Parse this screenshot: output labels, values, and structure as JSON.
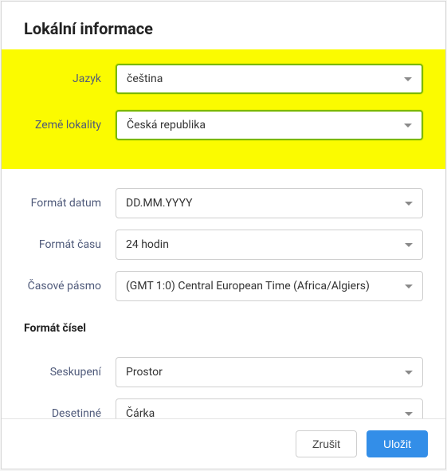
{
  "dialog": {
    "title": "Lokální informace"
  },
  "fields": {
    "language": {
      "label": "Jazyk",
      "value": "čeština"
    },
    "country": {
      "label": "Země lokality",
      "value": "Česká republika"
    },
    "dateFormat": {
      "label": "Formát datum",
      "value": "DD.MM.YYYY"
    },
    "timeFormat": {
      "label": "Formát času",
      "value": "24 hodin"
    },
    "timezone": {
      "label": "Časové pásmo",
      "value": "(GMT 1:0) Central European Time (Africa/Algiers)"
    },
    "grouping": {
      "label": "Seskupení",
      "value": "Prostor"
    },
    "decimal": {
      "label": "Desetinné",
      "value": "Čárka"
    }
  },
  "sections": {
    "numberFormat": "Formát čísel"
  },
  "footer": {
    "cancel": "Zrušit",
    "save": "Uložit"
  }
}
